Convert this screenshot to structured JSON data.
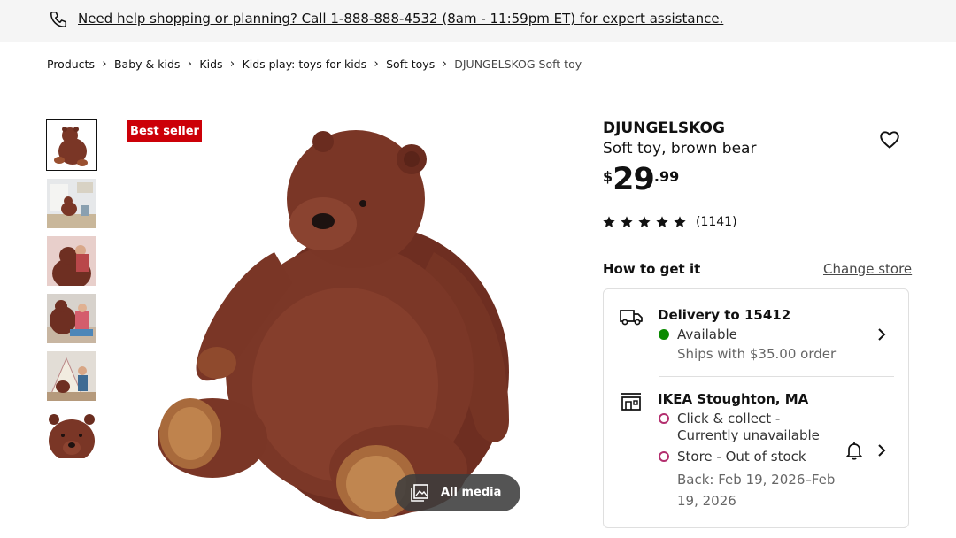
{
  "help_bar": {
    "text": "Need help shopping or planning? Call 1-888-888-4532 (8am - 11:59pm ET) for expert assistance.",
    "icon": "phone-icon"
  },
  "breadcrumb": {
    "items": [
      "Products",
      "Baby & kids",
      "Kids",
      "Kids play: toys for kids",
      "Soft toys"
    ],
    "current": "DJUNGELSKOG Soft toy"
  },
  "gallery": {
    "thumbnail_count": 6,
    "selected_index": 0,
    "badge": "Best seller",
    "all_media_label": "All media"
  },
  "product": {
    "name": "DJUNGELSKOG",
    "description": "Soft toy, brown bear",
    "price": {
      "currency": "$",
      "integer": "29",
      "decimal": ".99"
    },
    "rating": {
      "stars": 5,
      "count": "(1141)"
    }
  },
  "availability": {
    "heading": "How to get it",
    "change_store": "Change store",
    "delivery": {
      "title": "Delivery to 15412",
      "status": "Available",
      "note": "Ships with $35.00 order"
    },
    "store": {
      "title": "IKEA Stoughton, MA",
      "click_collect_line1": "Click & collect -",
      "click_collect_line2": "Currently unavailable",
      "stock": "Store - Out of stock",
      "back_line1": "Back: Feb 19, 2026–Feb",
      "back_line2": "19, 2026"
    }
  },
  "colors": {
    "badge": "#cc0008",
    "available": "#0a8a00",
    "unavailable": "#b32e6e",
    "bear": "#7a3626"
  }
}
